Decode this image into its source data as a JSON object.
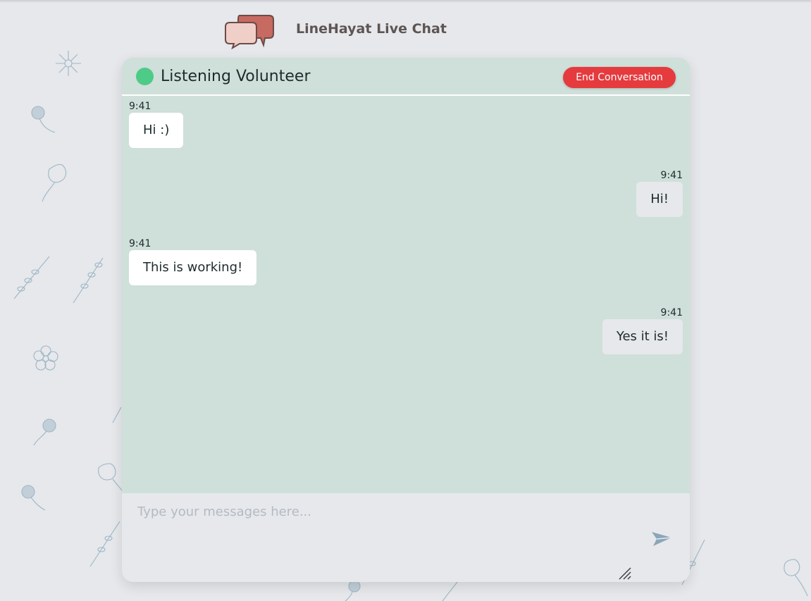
{
  "app": {
    "title": "LineHayat Live Chat",
    "logo_icon": "chat-bubbles-icon"
  },
  "chat": {
    "partner_name": "Listening Volunteer",
    "status": "online",
    "status_color": "#4ecb87",
    "end_button_label": "End Conversation",
    "end_button_color": "#e53b3e"
  },
  "messages": [
    {
      "direction": "received",
      "time": "9:41",
      "text": "Hi :)"
    },
    {
      "direction": "sent",
      "time": "9:41",
      "text": "Hi!"
    },
    {
      "direction": "received",
      "time": "9:41",
      "text": "This is working!"
    },
    {
      "direction": "sent",
      "time": "9:41",
      "text": "Yes it is!"
    }
  ],
  "composer": {
    "placeholder": "Type your messages here...",
    "value": "",
    "send_icon": "paper-plane-icon"
  },
  "colors": {
    "page_background": "#e6e8eb",
    "chat_background": "#cfdfd9",
    "received_bubble": "#ffffff",
    "sent_bubble": "#e6e8eb"
  }
}
